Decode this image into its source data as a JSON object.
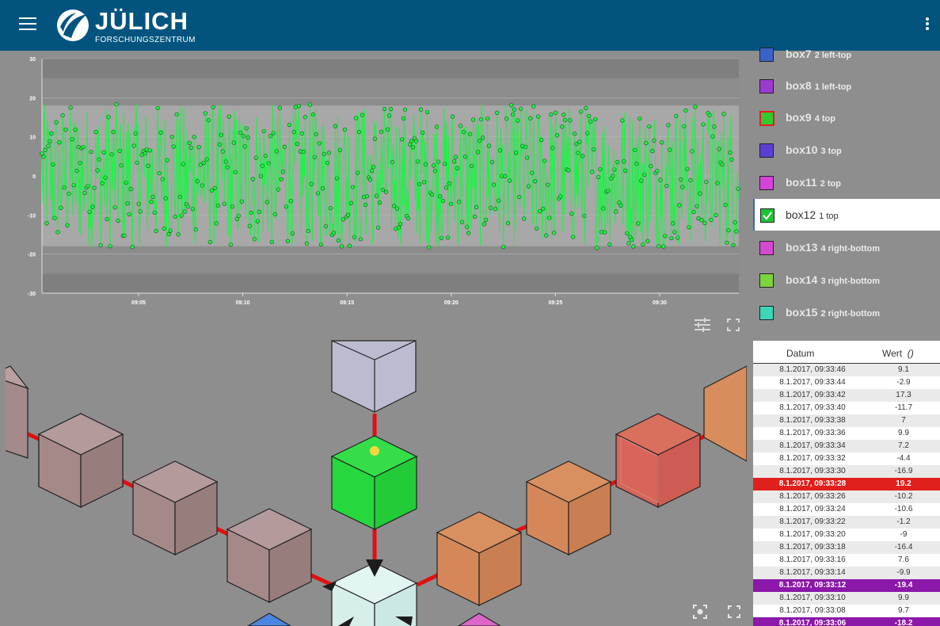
{
  "header": {
    "brand_name": "JÜLICH",
    "brand_sub": "FORSCHUNGSZENTRUM",
    "bar_color": "#02547f",
    "menu_icon": "hamburger-menu-icon",
    "more_icon": "more-vertical-icon"
  },
  "chart_data": {
    "type": "line",
    "series": [
      {
        "color": "#19f542",
        "markers": "circle"
      }
    ],
    "y_ticks": [
      "30",
      "20",
      "10",
      "0",
      "-10",
      "-20",
      "-30"
    ],
    "x_ticks": [
      "09:05",
      "09:10",
      "09:15",
      "09:20",
      "09:25",
      "09:30"
    ],
    "ylim": [
      -30,
      30
    ],
    "band_inner": [
      -18,
      18
    ],
    "band_outer": [
      -25,
      25
    ]
  },
  "chart_tools": {
    "settings_icon": "sliders-icon",
    "fullscreen_icon": "fullscreen-icon"
  },
  "legend": [
    {
      "name": "box7",
      "extra": "2 left-top",
      "color": "#3a63c8",
      "active": false
    },
    {
      "name": "box8",
      "extra": "1 left-top",
      "color": "#9b3ad0",
      "active": false
    },
    {
      "name": "box9",
      "extra": "4 top",
      "color": "#34c92d",
      "active": false,
      "border": "#e02020"
    },
    {
      "name": "box10",
      "extra": "3 top",
      "color": "#5b3fd3",
      "active": false
    },
    {
      "name": "box11",
      "extra": "2 top",
      "color": "#d444d9",
      "active": false
    },
    {
      "name": "box12",
      "extra": "1 top",
      "color": "#1ec436",
      "active": true
    },
    {
      "name": "box13",
      "extra": "4 right-bottom",
      "color": "#d44ad0",
      "active": false
    },
    {
      "name": "box14",
      "extra": "3 right-bottom",
      "color": "#7dd53e",
      "active": false
    },
    {
      "name": "box15",
      "extra": "2 right-bottom",
      "color": "#3cd6b8",
      "active": false
    }
  ],
  "table": {
    "col_datum": "Datum",
    "col_wert": "Wert",
    "col_unit": "()",
    "rows": [
      {
        "d": "8.1.2017, 09:33:46",
        "v": "9.1"
      },
      {
        "d": "8.1.2017, 09:33:44",
        "v": "-2.9"
      },
      {
        "d": "8.1.2017, 09:33:42",
        "v": "17.3"
      },
      {
        "d": "8.1.2017, 09:33:40",
        "v": "-11.7"
      },
      {
        "d": "8.1.2017, 09:33:38",
        "v": "7"
      },
      {
        "d": "8.1.2017, 09:33:36",
        "v": "9.9"
      },
      {
        "d": "8.1.2017, 09:33:34",
        "v": "7.2"
      },
      {
        "d": "8.1.2017, 09:33:32",
        "v": "-4.4"
      },
      {
        "d": "8.1.2017, 09:33:30",
        "v": "-16.9"
      },
      {
        "d": "8.1.2017, 09:33:28",
        "v": "19.2",
        "hl": "red"
      },
      {
        "d": "8.1.2017, 09:33:26",
        "v": "-10.2"
      },
      {
        "d": "8.1.2017, 09:33:24",
        "v": "-10.6"
      },
      {
        "d": "8.1.2017, 09:33:22",
        "v": "-1.2"
      },
      {
        "d": "8.1.2017, 09:33:20",
        "v": "-9"
      },
      {
        "d": "8.1.2017, 09:33:18",
        "v": "-16.4"
      },
      {
        "d": "8.1.2017, 09:33:16",
        "v": "7.6"
      },
      {
        "d": "8.1.2017, 09:33:14",
        "v": "-9.9"
      },
      {
        "d": "8.1.2017, 09:33:12",
        "v": "-19.4",
        "hl": "purple"
      },
      {
        "d": "8.1.2017, 09:33:10",
        "v": "9.9"
      },
      {
        "d": "8.1.2017, 09:33:08",
        "v": "9.7"
      },
      {
        "d": "8.1.2017, 09:33:06",
        "v": "-18.2",
        "hl": "purple"
      }
    ]
  },
  "scene_tools": {
    "focus_icon": "focus-center-icon",
    "fullscreen_icon": "fullscreen-icon"
  }
}
